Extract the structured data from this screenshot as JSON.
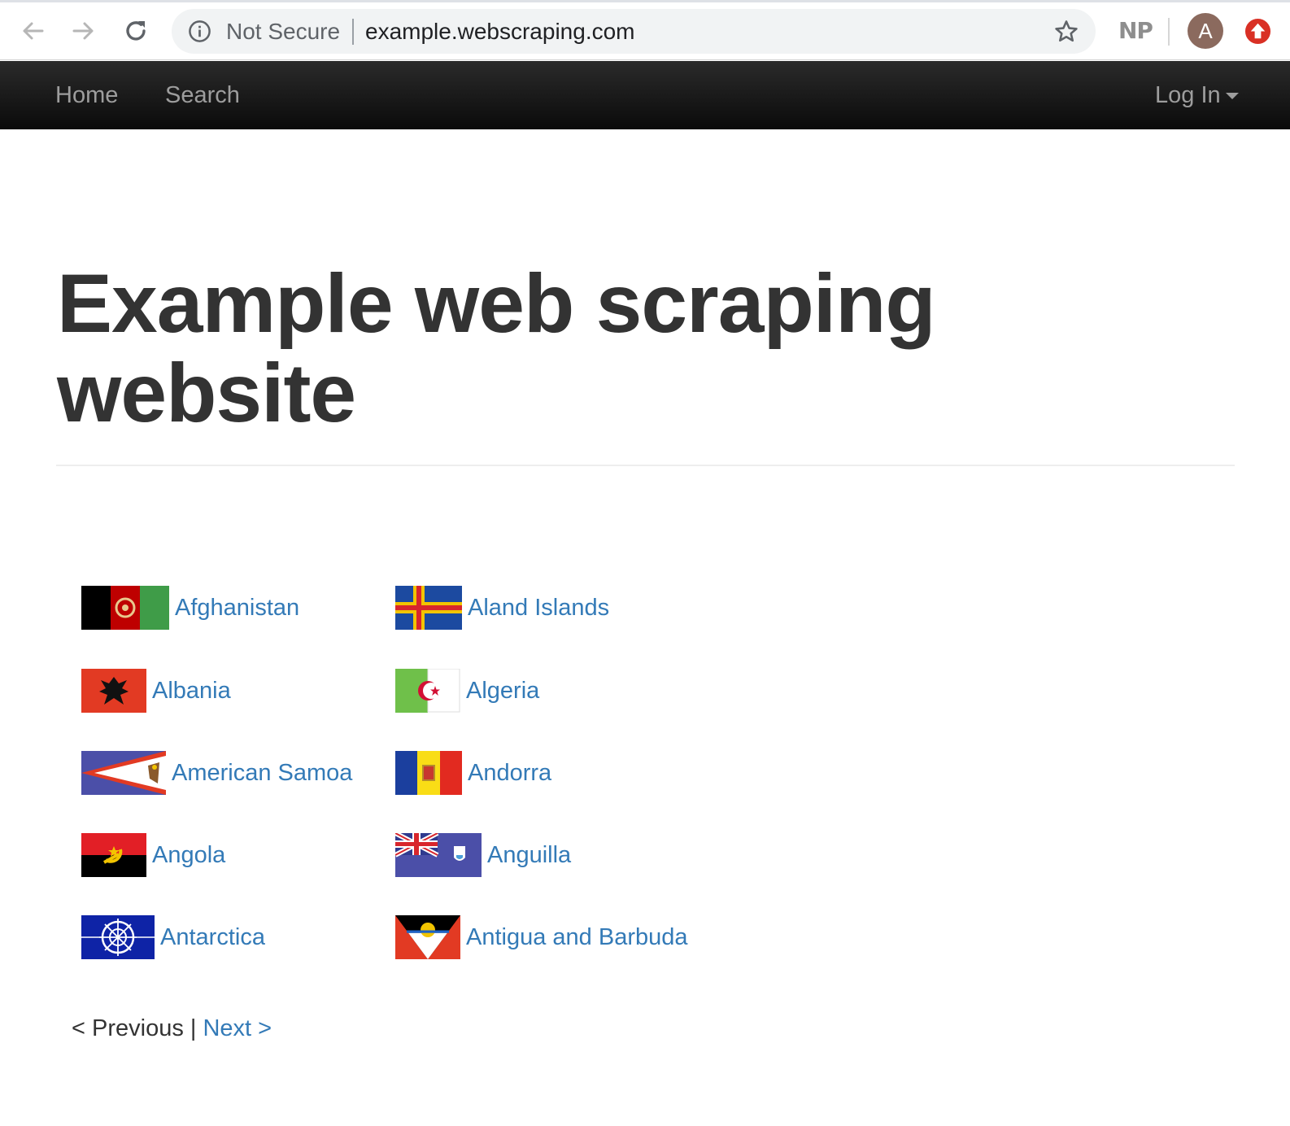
{
  "browser": {
    "security_label": "Not Secure",
    "url": "example.webscraping.com",
    "extension_label": "NP",
    "profile_initial": "A",
    "icons": [
      "back-arrow-icon",
      "forward-arrow-icon",
      "reload-icon",
      "info-icon",
      "star-icon",
      "update-icon"
    ]
  },
  "navbar": {
    "home": "Home",
    "search": "Search",
    "login": "Log In"
  },
  "page": {
    "title": "Example web scraping website"
  },
  "countries": [
    {
      "name": "Afghanistan"
    },
    {
      "name": "Aland Islands"
    },
    {
      "name": "Albania"
    },
    {
      "name": "Algeria"
    },
    {
      "name": "American Samoa"
    },
    {
      "name": "Andorra"
    },
    {
      "name": "Angola"
    },
    {
      "name": "Anguilla"
    },
    {
      "name": "Antarctica"
    },
    {
      "name": "Antigua and Barbuda"
    }
  ],
  "pager": {
    "previous": "< Previous",
    "separator": " | ",
    "next": "Next >"
  },
  "colors": {
    "link": "#337ab7",
    "navbar_bg": "#101010",
    "navbar_text": "#9d9d9d",
    "title_text": "#333333"
  }
}
